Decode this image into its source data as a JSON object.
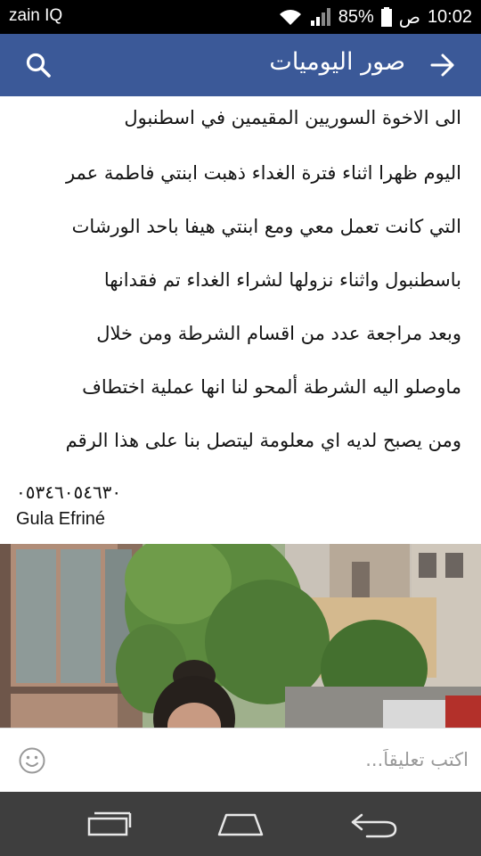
{
  "statusbar": {
    "carrier": "zain IQ",
    "battery": "85%",
    "ampm": "ص",
    "time": "10:02",
    "icons": [
      "wifi-icon",
      "signal-icon",
      "battery-icon"
    ]
  },
  "header": {
    "title": "صور اليوميات",
    "icons": [
      "search-icon",
      "back-arrow-icon"
    ],
    "color": "#3b5998"
  },
  "post": {
    "lines": [
      "الى الاخوة السوريين المقيمين في اسطنبول",
      "اليوم  ظهرا اثناء فترة الغداء  ذهبت ابنتي فاطمة عمر",
      "التي كانت تعمل معي ومع ابنتي هيفا باحد الورشات",
      "باسطنبول  واثناء نزولها لشراء  الغداء  تم فقدانها",
      "وبعد مراجعة عدد من اقسام الشرطة  ومن خلال",
      "ماوصلو اليه الشرطة  ألمحو لنا انها عملية اختطاف",
      "ومن يصبح لديه اي معلومة ليتصل بنا على هذا الرقم"
    ],
    "phone": "٠٥٣٤٦٠٥٤٦٣٠",
    "author": "Gula Efriné"
  },
  "comment": {
    "placeholder": "اكتب تعليقاً...",
    "icon": "smiley-icon"
  },
  "navbar": {
    "icons": [
      "recent-apps-icon",
      "home-icon",
      "back-icon"
    ]
  }
}
